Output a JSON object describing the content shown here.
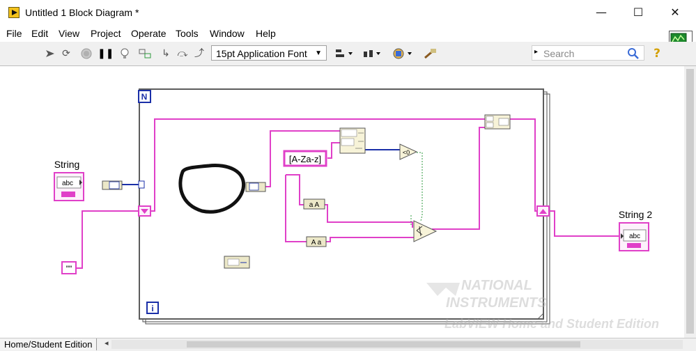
{
  "window": {
    "title": "Untitled 1 Block Diagram *"
  },
  "menu": [
    "File",
    "Edit",
    "View",
    "Project",
    "Operate",
    "Tools",
    "Window",
    "Help"
  ],
  "toolbar": {
    "font_value": "15pt Application Font",
    "search_placeholder": "Search"
  },
  "icon_badge": "1",
  "diagram": {
    "for_loop_count_terminal": "N",
    "for_loop_iteration_terminal": "i",
    "string_control_label": "String",
    "string_control_text": "abc",
    "string_indicator_label": "String 2",
    "string_indicator_text": "abc",
    "empty_string_constant": "\"\"",
    "regex_constant": "[A-Za-z]",
    "to_upper_label": "a A",
    "to_lower_label": "A a",
    "compare_label": "<0"
  },
  "watermark": {
    "brand_line1": "NATIONAL",
    "brand_line2": "INSTRUMENTS",
    "edition": "LabVIEW  Home and Student Edition"
  },
  "status": {
    "edition_label": "Home/Student Edition"
  },
  "colors": {
    "string_wire": "#e040c8",
    "numeric_wire": "#1a2fa8",
    "boolean_wire": "#2e9a3e",
    "loop_border": "#5c5c5c"
  }
}
